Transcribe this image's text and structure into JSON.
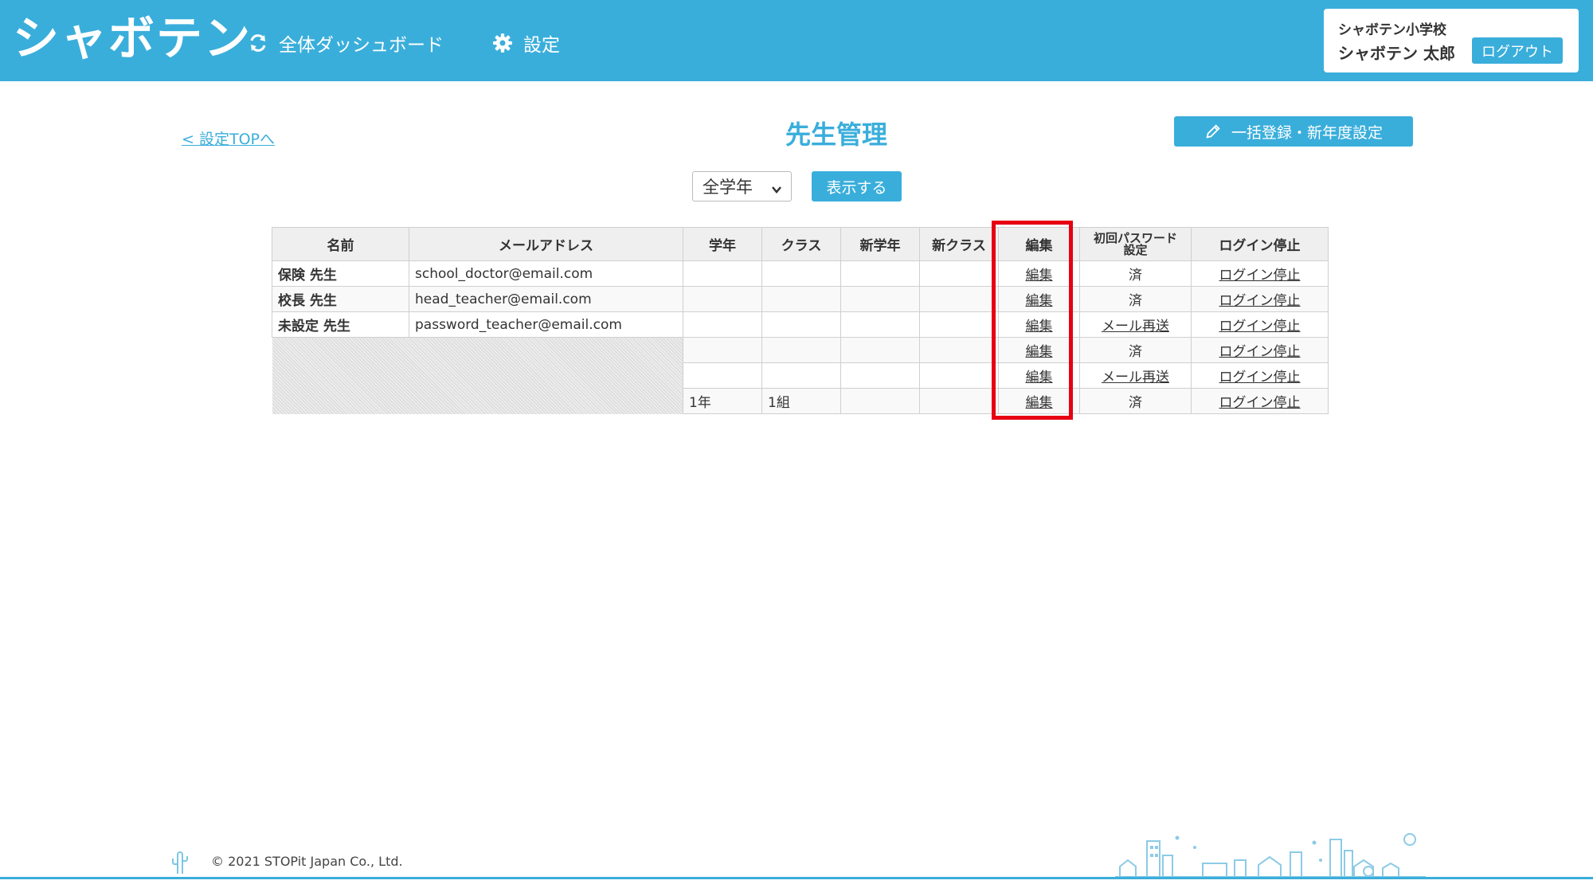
{
  "header": {
    "logo": "シャボテン",
    "nav": [
      {
        "label": "全体ダッシュボード",
        "icon": "refresh-icon"
      },
      {
        "label": "設定",
        "icon": "gear-icon"
      }
    ],
    "user": {
      "school": "シャボテン小学校",
      "name": "シャボテン 太郎",
      "logout_label": "ログアウト"
    }
  },
  "page": {
    "back_link": "< 設定TOPへ",
    "title": "先生管理",
    "bulk_button": "一括登録・新年度設定",
    "bulk_icon": "pencil-icon",
    "grade_filter": {
      "selected": "全学年",
      "icon": "chevron-down-icon"
    },
    "show_button": "表示する"
  },
  "table": {
    "columns": [
      "名前",
      "メールアドレス",
      "学年",
      "クラス",
      "新学年",
      "新クラス",
      "編集",
      "初回パスワード設定",
      "ログイン停止"
    ],
    "pw_header_line1": "初回パスワード",
    "pw_header_line2": "設定",
    "rows": [
      {
        "name": "保険 先生",
        "email": "school_doctor@email.com",
        "grade": "",
        "class": "",
        "new_grade": "",
        "new_class": "",
        "edit": "編集",
        "password": "済",
        "login_stop": "ログイン停止"
      },
      {
        "name": "校長 先生",
        "email": "head_teacher@email.com",
        "grade": "",
        "class": "",
        "new_grade": "",
        "new_class": "",
        "edit": "編集",
        "password": "済",
        "login_stop": "ログイン停止"
      },
      {
        "name": "未設定 先生",
        "email": "password_teacher@email.com",
        "grade": "",
        "class": "",
        "new_grade": "",
        "new_class": "",
        "edit": "編集",
        "password": "メール再送",
        "login_stop": "ログイン停止"
      },
      {
        "name": "",
        "email": "",
        "grade": "",
        "class": "",
        "new_grade": "",
        "new_class": "",
        "edit": "編集",
        "password": "済",
        "login_stop": "ログイン停止"
      },
      {
        "name": "",
        "email": "",
        "grade": "",
        "class": "",
        "new_grade": "",
        "new_class": "",
        "edit": "編集",
        "password": "メール再送",
        "login_stop": "ログイン停止"
      },
      {
        "name": "",
        "email": "",
        "grade": "1年",
        "class": "1組",
        "new_grade": "",
        "new_class": "",
        "edit": "編集",
        "password": "済",
        "login_stop": "ログイン停止"
      }
    ]
  },
  "footer": {
    "copyright": "© 2021 STOPit Japan Co., Ltd."
  },
  "colors": {
    "brand": "#3aaedb",
    "highlight": "#e60012",
    "header_bg": "#efefef"
  }
}
